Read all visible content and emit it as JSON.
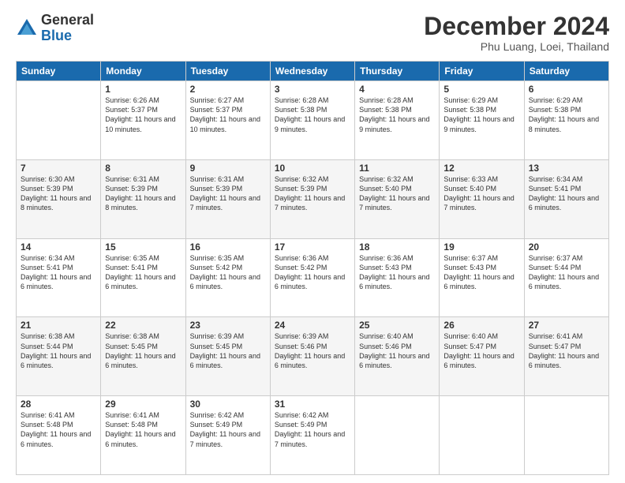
{
  "header": {
    "logo_general": "General",
    "logo_blue": "Blue",
    "month_title": "December 2024",
    "location": "Phu Luang, Loei, Thailand"
  },
  "calendar": {
    "headers": [
      "Sunday",
      "Monday",
      "Tuesday",
      "Wednesday",
      "Thursday",
      "Friday",
      "Saturday"
    ],
    "weeks": [
      [
        null,
        {
          "day": "2",
          "sunrise": "6:27 AM",
          "sunset": "5:37 PM",
          "daylight": "11 hours and 10 minutes."
        },
        {
          "day": "3",
          "sunrise": "6:28 AM",
          "sunset": "5:38 PM",
          "daylight": "11 hours and 9 minutes."
        },
        {
          "day": "4",
          "sunrise": "6:28 AM",
          "sunset": "5:38 PM",
          "daylight": "11 hours and 9 minutes."
        },
        {
          "day": "5",
          "sunrise": "6:29 AM",
          "sunset": "5:38 PM",
          "daylight": "11 hours and 9 minutes."
        },
        {
          "day": "6",
          "sunrise": "6:29 AM",
          "sunset": "5:38 PM",
          "daylight": "11 hours and 8 minutes."
        },
        {
          "day": "7",
          "sunrise": "6:30 AM",
          "sunset": "5:39 PM",
          "daylight": "11 hours and 8 minutes."
        }
      ],
      [
        {
          "day": "1",
          "sunrise": "6:26 AM",
          "sunset": "5:37 PM",
          "daylight": "11 hours and 10 minutes."
        },
        {
          "day": "2",
          "sunrise": "6:27 AM",
          "sunset": "5:37 PM",
          "daylight": "11 hours and 10 minutes."
        },
        {
          "day": "3",
          "sunrise": "6:28 AM",
          "sunset": "5:38 PM",
          "daylight": "11 hours and 9 minutes."
        },
        {
          "day": "4",
          "sunrise": "6:28 AM",
          "sunset": "5:38 PM",
          "daylight": "11 hours and 9 minutes."
        },
        {
          "day": "5",
          "sunrise": "6:29 AM",
          "sunset": "5:38 PM",
          "daylight": "11 hours and 9 minutes."
        },
        {
          "day": "6",
          "sunrise": "6:29 AM",
          "sunset": "5:38 PM",
          "daylight": "11 hours and 8 minutes."
        },
        {
          "day": "7",
          "sunrise": "6:30 AM",
          "sunset": "5:39 PM",
          "daylight": "11 hours and 8 minutes."
        }
      ],
      [
        {
          "day": "8",
          "sunrise": "6:31 AM",
          "sunset": "5:39 PM",
          "daylight": "11 hours and 8 minutes."
        },
        {
          "day": "9",
          "sunrise": "6:31 AM",
          "sunset": "5:39 PM",
          "daylight": "11 hours and 7 minutes."
        },
        {
          "day": "10",
          "sunrise": "6:32 AM",
          "sunset": "5:39 PM",
          "daylight": "11 hours and 7 minutes."
        },
        {
          "day": "11",
          "sunrise": "6:32 AM",
          "sunset": "5:40 PM",
          "daylight": "11 hours and 7 minutes."
        },
        {
          "day": "12",
          "sunrise": "6:33 AM",
          "sunset": "5:40 PM",
          "daylight": "11 hours and 7 minutes."
        },
        {
          "day": "13",
          "sunrise": "6:34 AM",
          "sunset": "5:41 PM",
          "daylight": "11 hours and 6 minutes."
        },
        {
          "day": "14",
          "sunrise": "6:34 AM",
          "sunset": "5:41 PM",
          "daylight": "11 hours and 6 minutes."
        }
      ],
      [
        {
          "day": "15",
          "sunrise": "6:35 AM",
          "sunset": "5:41 PM",
          "daylight": "11 hours and 6 minutes."
        },
        {
          "day": "16",
          "sunrise": "6:35 AM",
          "sunset": "5:42 PM",
          "daylight": "11 hours and 6 minutes."
        },
        {
          "day": "17",
          "sunrise": "6:36 AM",
          "sunset": "5:42 PM",
          "daylight": "11 hours and 6 minutes."
        },
        {
          "day": "18",
          "sunrise": "6:36 AM",
          "sunset": "5:43 PM",
          "daylight": "11 hours and 6 minutes."
        },
        {
          "day": "19",
          "sunrise": "6:37 AM",
          "sunset": "5:43 PM",
          "daylight": "11 hours and 6 minutes."
        },
        {
          "day": "20",
          "sunrise": "6:37 AM",
          "sunset": "5:44 PM",
          "daylight": "11 hours and 6 minutes."
        },
        {
          "day": "21",
          "sunrise": "6:38 AM",
          "sunset": "5:44 PM",
          "daylight": "11 hours and 6 minutes."
        }
      ],
      [
        {
          "day": "22",
          "sunrise": "6:38 AM",
          "sunset": "5:45 PM",
          "daylight": "11 hours and 6 minutes."
        },
        {
          "day": "23",
          "sunrise": "6:39 AM",
          "sunset": "5:45 PM",
          "daylight": "11 hours and 6 minutes."
        },
        {
          "day": "24",
          "sunrise": "6:39 AM",
          "sunset": "5:46 PM",
          "daylight": "11 hours and 6 minutes."
        },
        {
          "day": "25",
          "sunrise": "6:40 AM",
          "sunset": "5:46 PM",
          "daylight": "11 hours and 6 minutes."
        },
        {
          "day": "26",
          "sunrise": "6:40 AM",
          "sunset": "5:47 PM",
          "daylight": "11 hours and 6 minutes."
        },
        {
          "day": "27",
          "sunrise": "6:41 AM",
          "sunset": "5:47 PM",
          "daylight": "11 hours and 6 minutes."
        },
        {
          "day": "28",
          "sunrise": "6:41 AM",
          "sunset": "5:48 PM",
          "daylight": "11 hours and 6 minutes."
        }
      ],
      [
        {
          "day": "29",
          "sunrise": "6:41 AM",
          "sunset": "5:48 PM",
          "daylight": "11 hours and 6 minutes."
        },
        {
          "day": "30",
          "sunrise": "6:42 AM",
          "sunset": "5:49 PM",
          "daylight": "11 hours and 7 minutes."
        },
        {
          "day": "31",
          "sunrise": "6:42 AM",
          "sunset": "5:49 PM",
          "daylight": "11 hours and 7 minutes."
        },
        null,
        null,
        null,
        null
      ]
    ]
  }
}
